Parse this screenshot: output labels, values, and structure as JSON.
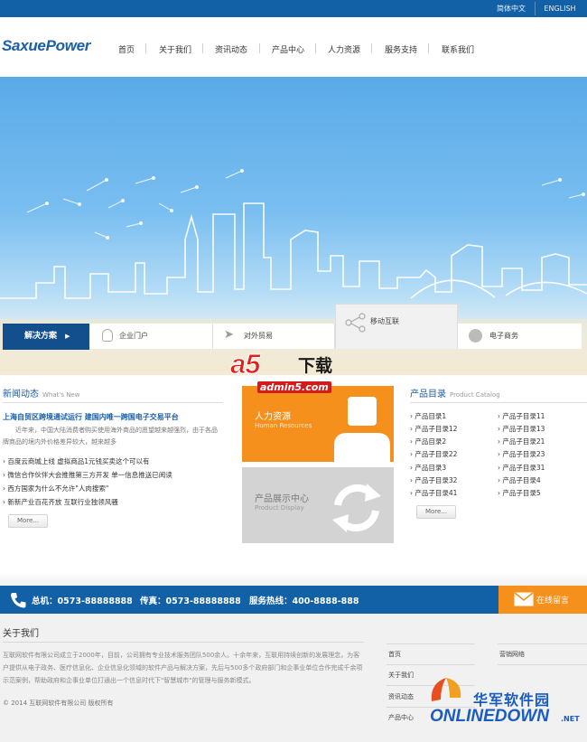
{
  "topbar": {
    "lang_cn": "简体中文",
    "lang_en": "ENGLISH"
  },
  "header": {
    "logo": "SaxuePower",
    "nav": [
      "首页",
      "关于我们",
      "资讯动态",
      "产品中心",
      "人力资源",
      "服务支持",
      "联系我们"
    ]
  },
  "solutions": {
    "main": "解决方案",
    "tabs": [
      "企业门户",
      "对外贸易",
      "移动互联",
      "电子商务"
    ]
  },
  "news": {
    "title": "新闻动态",
    "subtitle": "What's New",
    "headline": "上海自贸区跨境通试运行 建国内唯一跨国电子交易平台",
    "summary": "近年来，中国大陆消费者购买使用海外商品的愿望越来越强烈，由于各品牌商品的境内外价格差异较大，越来越多",
    "items": [
      "百度云商城上线 虚拟商品1元钱买卖这个可以有",
      "微信合作伙伴大会推推第三方开发 单一信息推送已阅读",
      "西方国家为什么不允许\"人肉搜索\"",
      "新新产业百花齐放 互联行业独领风骚"
    ],
    "more": "More..."
  },
  "tiles": {
    "hr": {
      "title": "人力资源",
      "subtitle": "Human Resources"
    },
    "product": {
      "title": "产品展示中心",
      "subtitle": "Product Display"
    }
  },
  "catalog": {
    "title": "产品目录",
    "subtitle": "Product Catalog",
    "col1": [
      "产品目录1",
      "产品子目录12",
      "产品目录2",
      "产品子目录22",
      "产品目录3",
      "产品子目录32",
      "产品子目录41"
    ],
    "col2": [
      "产品子目录11",
      "产品子目录13",
      "产品子目录21",
      "产品子目录23",
      "产品子目录31",
      "产品子目录4",
      "产品子目录5"
    ],
    "more": "More..."
  },
  "contact": {
    "phone_label": "总机：",
    "phone": "0573-88888888",
    "fax_label": "传真：",
    "fax": "0573-88888888",
    "hotline_label": "服务热线：",
    "hotline": "400-8888-888",
    "message": "在线留言"
  },
  "footer": {
    "about_title": "关于我们",
    "about_text": "互联网软件有限公司成立于2000年，目前，公司拥有专业技术服务团队500余人。十余年来，互联用持续创新的发展理念，为客户提供从电子政务、医疗信息化、企业信息化领域的软件产品与解决方案，先后与500多个政府部门和企事业单位合作完成千余项示范案例，帮助政府和企事业单位打通出一个信息时代下\"智慧城市\"的管理与服务新模式。",
    "copyright": "© 2014 互联网软件有限公司 版权所有",
    "links_col1": [
      "首页",
      "关于我们",
      "资讯动态",
      "产品中心"
    ],
    "links_col2": [
      "营销网络"
    ]
  },
  "watermarks": {
    "a5_logo": "a5",
    "a5_zh": "下载",
    "a5_url": "admin5.com",
    "onlinedown_zh": "华军软件园",
    "onlinedown_en": "ONLINEDOWN",
    "onlinedown_net": ".NET"
  },
  "colors": {
    "brand_blue": "#1260a5",
    "accent_orange": "#f6901d",
    "sky": "#79bef0"
  }
}
